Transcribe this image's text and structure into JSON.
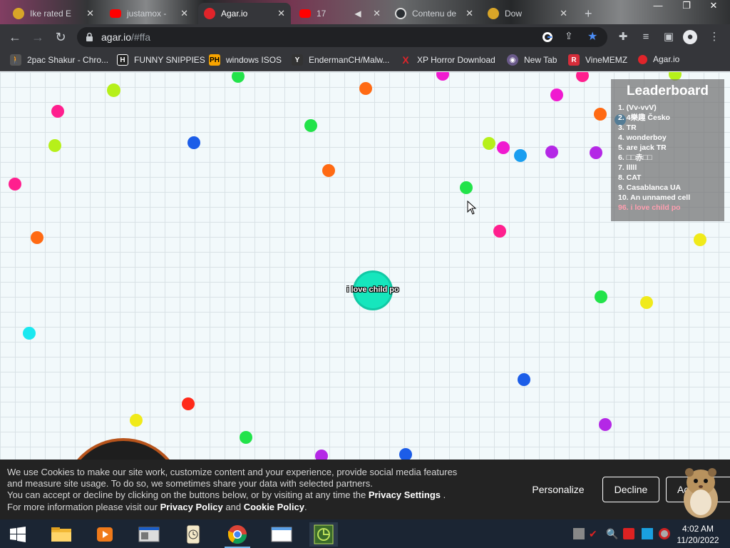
{
  "browser": {
    "tabs": [
      {
        "label": "Ike rated E",
        "icon_color": "#d8a528"
      },
      {
        "label": "justamox -",
        "icon_color": "#ff0000"
      },
      {
        "label": "Agar.io",
        "icon_color": "#e0242a"
      },
      {
        "label": "17",
        "icon_color": "#ff0000"
      },
      {
        "label": "Contenu de",
        "icon_color": "#9aa0a6"
      },
      {
        "label": "Dow",
        "icon_color": "#d8a528"
      }
    ],
    "new_tab": "+",
    "minimize": "—",
    "maximize": "❐",
    "close": "✕",
    "url_host": "agar.io",
    "url_path": "/#ffa",
    "bookmarks": [
      {
        "label": "2pac Shakur - Chro...",
        "icon": "🚶",
        "icon_color": "#555555"
      },
      {
        "label": "FUNNY SNIPPIES",
        "icon": "H",
        "icon_color": "#222222"
      },
      {
        "label": "windows ISOS",
        "icon": "PH",
        "icon_color": "#f7a400"
      },
      {
        "label": "EndermanCH/Malw...",
        "icon": "Y",
        "icon_color": "#333333"
      },
      {
        "label": "XP Horror Download",
        "icon": "X",
        "icon_color": "#e0242a"
      },
      {
        "label": "New Tab",
        "icon": "◉",
        "icon_color": "#6a5a8a"
      },
      {
        "label": "VineMEMZ",
        "icon": "R",
        "icon_color": "#d62d3a"
      },
      {
        "label": "Agar.io",
        "icon": "●",
        "icon_color": "#e0242a"
      }
    ]
  },
  "game": {
    "player_name": "i love child po",
    "player_color": "#16e6bd",
    "leaderboard": {
      "title": "Leaderboard",
      "rows": [
        "1. (Vv-vvV)",
        "2. 4樂趣 Česko",
        "3. TR",
        "4. wonderboy",
        "5. are jack TR",
        "6. □□赤□□",
        "7. lllll",
        "8. CAT",
        "9. Casablanca UA",
        "10. An unnamed cell"
      ],
      "player_row": "96. i love child po"
    },
    "pellet_colors": {
      "pink": "#ff1f8e",
      "lime": "#b6f01a",
      "green": "#22e34a",
      "orange": "#ff6a13",
      "blue": "#1c5de8",
      "purple": "#b428e6",
      "cyan": "#1ae8f0",
      "yellow": "#f0ea1a",
      "red": "#ff2a1a",
      "skyblue": "#1a9ef0",
      "magenta": "#f01ad0"
    }
  },
  "cookie_banner": {
    "line1": "We use Cookies to make our site work, customize content and your experience, provide social media features",
    "line2": "and measure site usage. To do so, we sometimes share your data with selected partners.",
    "line3_pre": "You can accept or decline by clicking on the buttons below, or by visiting at any time the ",
    "privacy_settings": "Privacy Settings",
    "line3_post": " .",
    "line4_pre": "For more information please visit our ",
    "privacy_policy": "Privacy Policy",
    "and": " and ",
    "cookie_policy": "Cookie Policy",
    "line4_post": ".",
    "personalize": "Personalize",
    "decline": "Decline",
    "accept": "Accept"
  },
  "taskbar": {
    "time": "4:02 AM",
    "date": "11/20/2022"
  }
}
